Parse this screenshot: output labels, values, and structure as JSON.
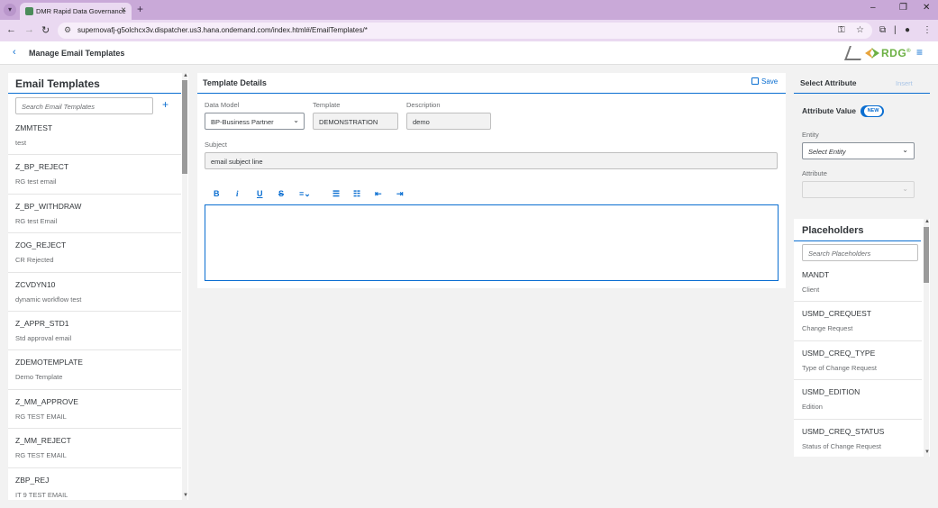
{
  "browser": {
    "tab_title": "DMR Rapid Data Governance",
    "url": "supernovafj-g5olchcx3v.dispatcher.us3.hana.ondemand.com/index.html#/EmailTemplates/*"
  },
  "header": {
    "page_title": "Manage Email Templates",
    "logo_text": "RDG",
    "logo_mark": "®"
  },
  "left_panel": {
    "title": "Email Templates",
    "search_placeholder": "Search Email Templates",
    "add_label": "+",
    "items": [
      {
        "name": "ZMMTEST",
        "desc": "test"
      },
      {
        "name": "Z_BP_REJECT",
        "desc": "RG test email"
      },
      {
        "name": "Z_BP_WITHDRAW",
        "desc": "RG test Email"
      },
      {
        "name": "ZOG_REJECT",
        "desc": "CR Rejected"
      },
      {
        "name": "ZCVDYN10",
        "desc": "dynamic workflow test"
      },
      {
        "name": "Z_APPR_STD1",
        "desc": "Std approval email"
      },
      {
        "name": "ZDEMOTEMPLATE",
        "desc": "Demo Template"
      },
      {
        "name": "Z_MM_APPROVE",
        "desc": "RG TEST EMAIL"
      },
      {
        "name": "Z_MM_REJECT",
        "desc": "RG TEST EMAIL"
      },
      {
        "name": "ZBP_REJ",
        "desc": "IT 9 TEST EMAIL"
      }
    ]
  },
  "details": {
    "title": "Template Details",
    "save_label": "Save",
    "data_model_label": "Data Model",
    "data_model_value": "BP-Business Partner",
    "template_label": "Template",
    "template_value": "DEMONSTRATION",
    "description_label": "Description",
    "description_value": "demo",
    "subject_label": "Subject",
    "subject_value": "email subject line",
    "toolbar": {
      "bold": "B",
      "italic": "i",
      "underline": "U",
      "strike": "S"
    }
  },
  "attributes": {
    "title": "Select Attribute",
    "insert_label": "Insert",
    "attribute_value_label": "Attribute Value",
    "toggle_label": "NEW",
    "entity_label": "Entity",
    "entity_placeholder": "Select Entity",
    "attribute_label": "Attribute"
  },
  "placeholders": {
    "title": "Placeholders",
    "search_placeholder": "Search Placeholders",
    "items": [
      {
        "name": "MANDT",
        "desc": "Client"
      },
      {
        "name": "USMD_CREQUEST",
        "desc": "Change Request"
      },
      {
        "name": "USMD_CREQ_TYPE",
        "desc": "Type of Change Request"
      },
      {
        "name": "USMD_EDITION",
        "desc": "Edition"
      },
      {
        "name": "USMD_CREQ_STATUS",
        "desc": "Status of Change Request"
      }
    ]
  },
  "colors": {
    "accent": "#0a6ed1",
    "chrome": "#c9a9d8",
    "background": "#f2f2f2"
  }
}
